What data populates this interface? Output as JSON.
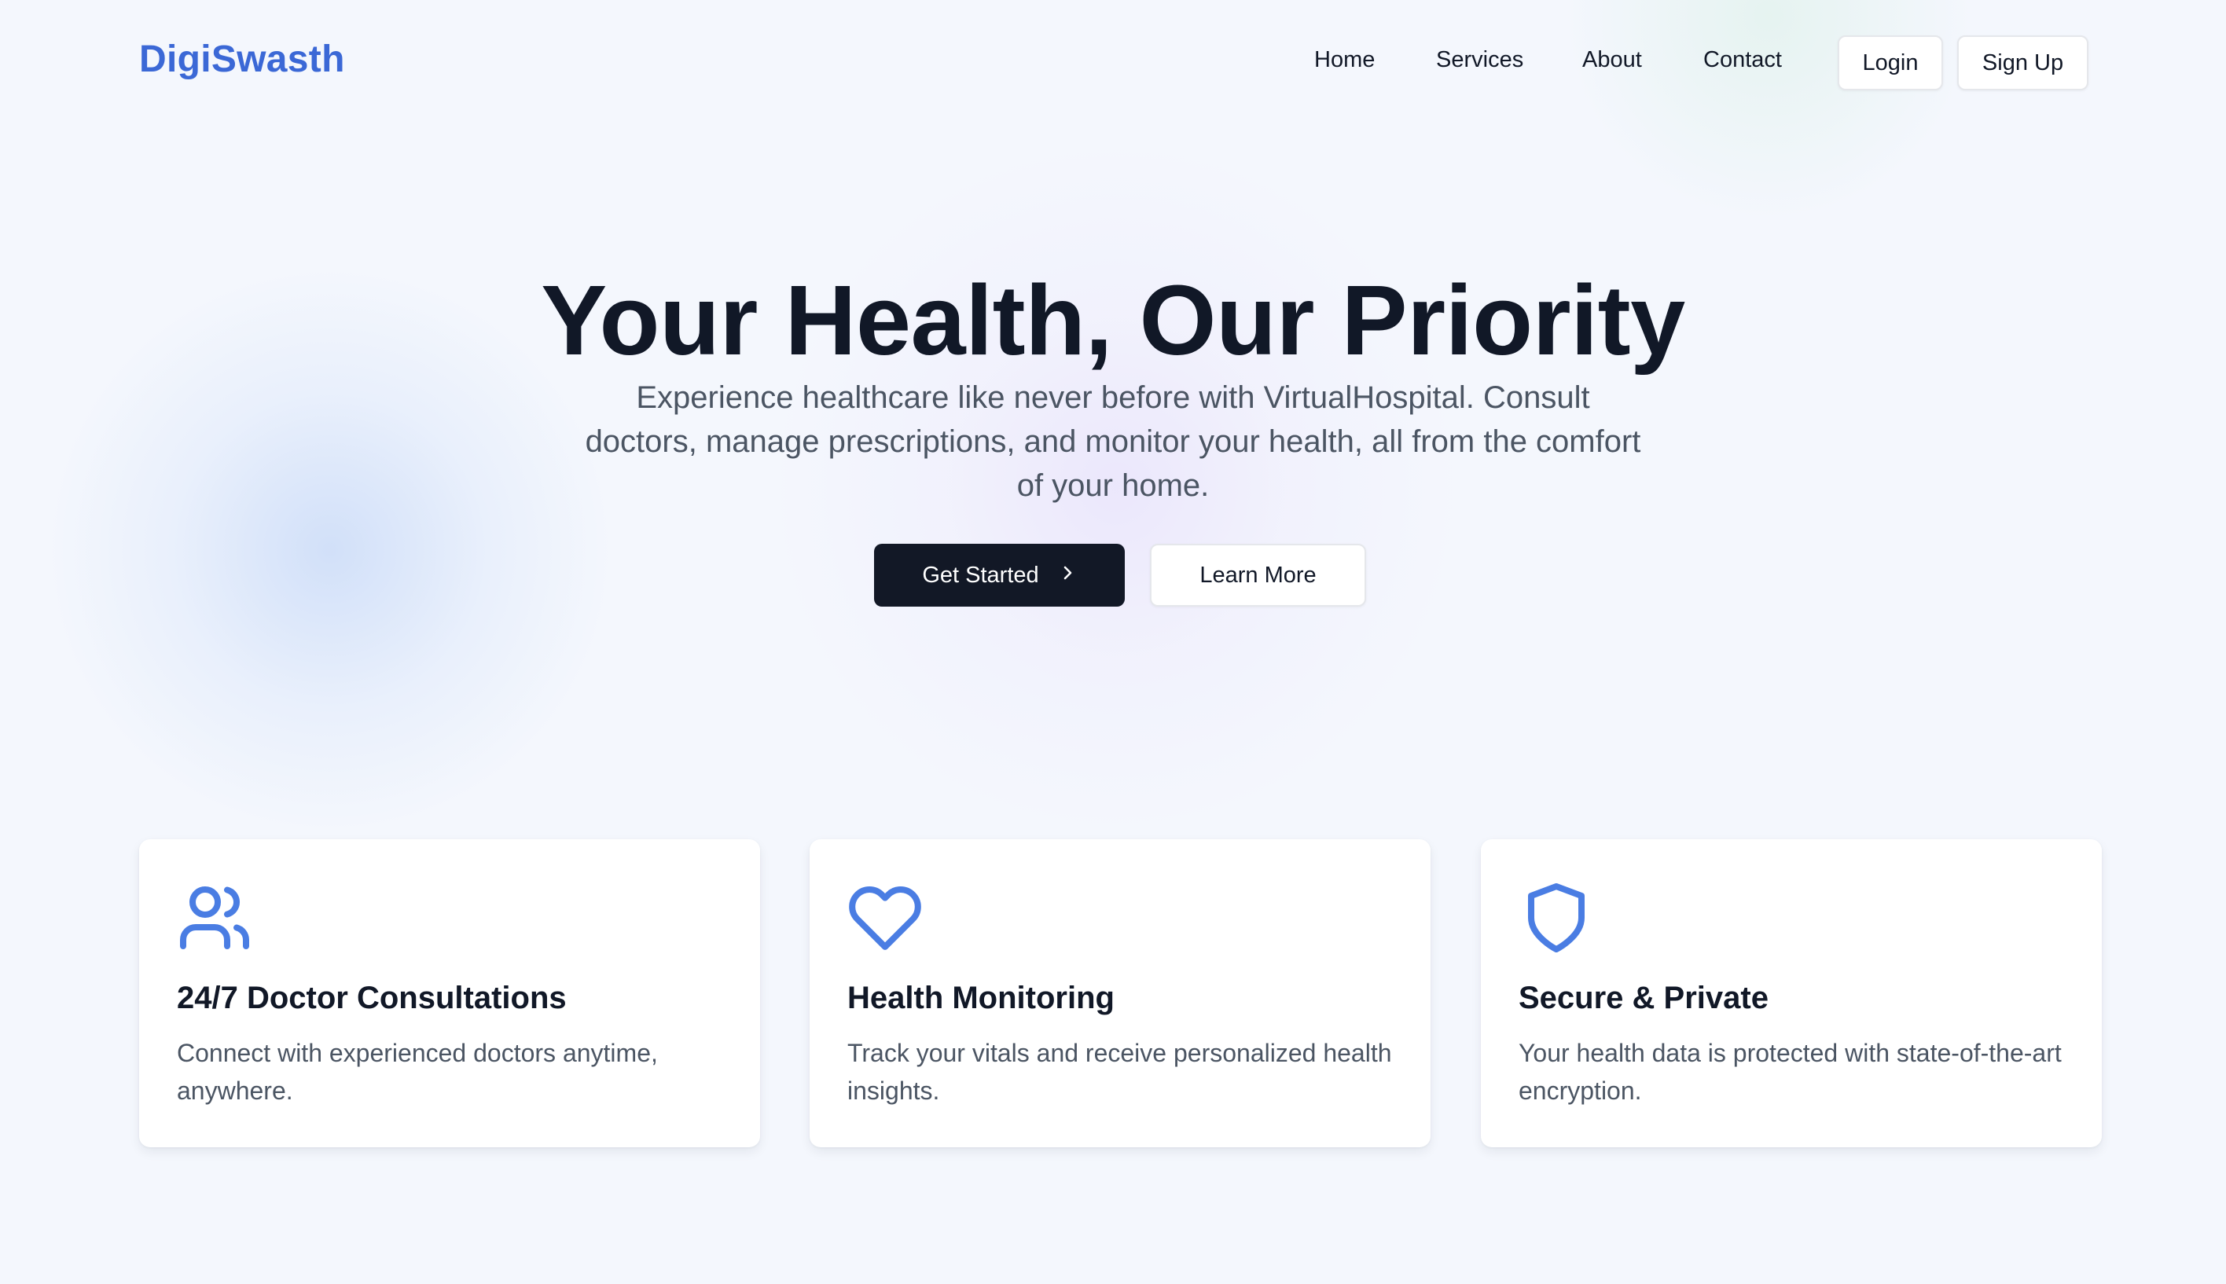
{
  "brand": {
    "name": "DigiSwasth",
    "color": "#3b68d6"
  },
  "nav": {
    "links": [
      "Home",
      "Services",
      "About",
      "Contact"
    ],
    "login_label": "Login",
    "signup_label": "Sign Up"
  },
  "hero": {
    "title": "Your Health, Our Priority",
    "subtitle": "Experience healthcare like never before with VirtualHospital. Consult doctors, manage prescriptions, and monitor your health, all from the comfort of your home.",
    "primary_cta": "Get Started",
    "primary_cta_icon": "chevron-right-icon",
    "secondary_cta": "Learn More"
  },
  "features": [
    {
      "icon": "users-icon",
      "title": "24/7 Doctor Consultations",
      "description": "Connect with experienced doctors anytime, anywhere."
    },
    {
      "icon": "heart-icon",
      "title": "Health Monitoring",
      "description": "Track your vitals and receive personalized health insights."
    },
    {
      "icon": "shield-icon",
      "title": "Secure & Private",
      "description": "Your health data is protected with state-of-the-art encryption."
    }
  ],
  "colors": {
    "accent": "#3b68d6",
    "icon": "#4a7de3",
    "primary_button": "#121826",
    "text_dark": "#111827",
    "text_muted": "#4b5563"
  }
}
